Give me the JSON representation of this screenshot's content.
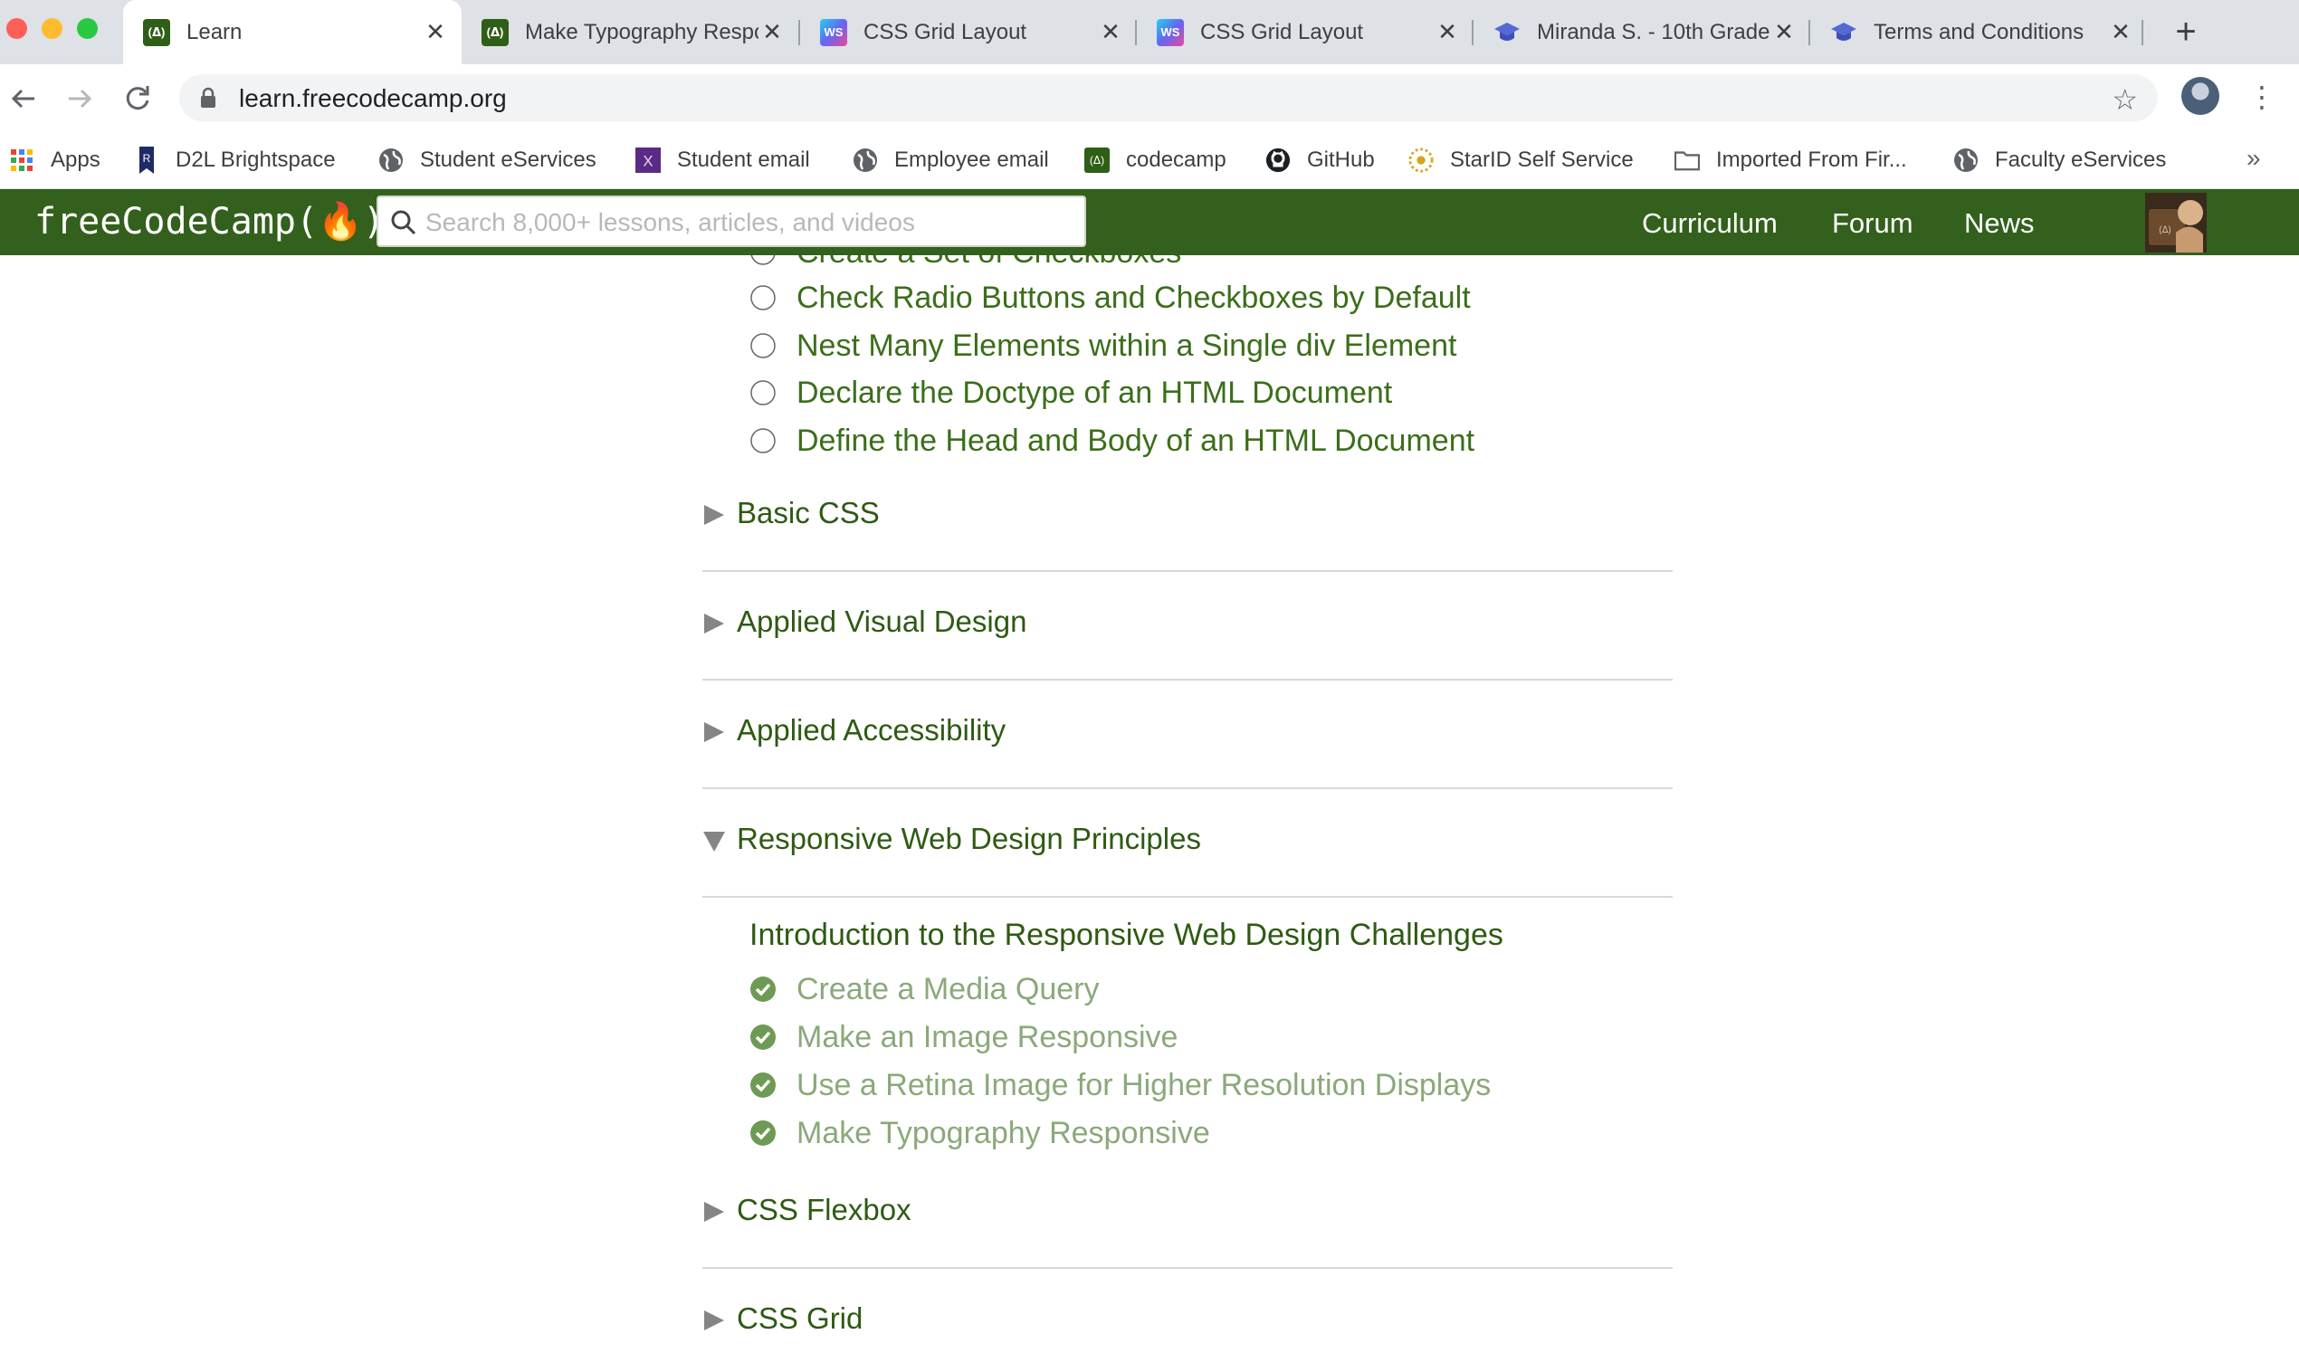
{
  "browser": {
    "tabs": [
      {
        "title": "Learn",
        "favicon": "freecodecamp-icon",
        "active": true
      },
      {
        "title": "Make Typography Responsive",
        "favicon": "freecodecamp-icon",
        "active": false
      },
      {
        "title": "CSS Grid Layout",
        "favicon": "webstorm-icon",
        "active": false
      },
      {
        "title": "CSS Grid Layout",
        "favicon": "webstorm-icon",
        "active": false
      },
      {
        "title": "Miranda S. - 10th Grade",
        "favicon": "graduation-cap-icon",
        "active": false
      },
      {
        "title": "Terms and Conditions",
        "favicon": "graduation-cap-icon",
        "active": false
      }
    ],
    "url": "learn.freecodecamp.org",
    "bookmarks": [
      {
        "label": "Apps",
        "icon": "apps-grid-icon"
      },
      {
        "label": "D2L Brightspace",
        "icon": "d2l-icon"
      },
      {
        "label": "Student eServices",
        "icon": "globe-icon"
      },
      {
        "label": "Student email",
        "icon": "outlook-icon"
      },
      {
        "label": "Employee email",
        "icon": "globe-icon"
      },
      {
        "label": "codecamp",
        "icon": "freecodecamp-icon"
      },
      {
        "label": "GitHub",
        "icon": "github-icon"
      },
      {
        "label": "StarID Self Service",
        "icon": "star-seal-icon"
      },
      {
        "label": "Imported From Fir...",
        "icon": "folder-icon"
      },
      {
        "label": "Faculty eServices",
        "icon": "globe-icon"
      }
    ],
    "more_bookmarks": "»",
    "new_tab": "+"
  },
  "fcc": {
    "logo": "freeCodeCamp(🔥)",
    "search_placeholder": "Search 8,000+ lessons, articles, and videos",
    "nav": [
      "Curriculum",
      "Forum",
      "News"
    ]
  },
  "curriculum": {
    "partial_top": "Create a Set of Checkboxes",
    "html_challenges": [
      "Check Radio Buttons and Checkboxes by Default",
      "Nest Many Elements within a Single div Element",
      "Declare the Doctype of an HTML Document",
      "Define the Head and Body of an HTML Document"
    ],
    "sections": [
      {
        "title": "Basic CSS",
        "expanded": false
      },
      {
        "title": "Applied Visual Design",
        "expanded": false
      },
      {
        "title": "Applied Accessibility",
        "expanded": false
      },
      {
        "title": "Responsive Web Design Principles",
        "expanded": true
      },
      {
        "title": "CSS Flexbox",
        "expanded": false
      },
      {
        "title": "CSS Grid",
        "expanded": false
      }
    ],
    "rwd_intro": "Introduction to the Responsive Web Design Challenges",
    "rwd_challenges": [
      {
        "label": "Create a Media Query",
        "completed": true
      },
      {
        "label": "Make an Image Responsive",
        "completed": true
      },
      {
        "label": "Use a Retina Image for Higher Resolution Displays",
        "completed": true
      },
      {
        "label": "Make Typography Responsive",
        "completed": true
      }
    ]
  },
  "colors": {
    "fcc_green": "#33601c",
    "link_green": "#2e5a12",
    "completed_green": "#8aa97a",
    "check_green": "#6f9a55"
  }
}
